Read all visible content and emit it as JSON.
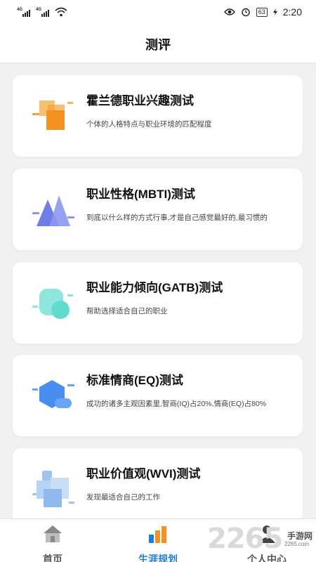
{
  "status_bar": {
    "signal1_label": "4G",
    "signal2_label": "4G",
    "battery": "63",
    "time": "2:20"
  },
  "header": {
    "title": "测评"
  },
  "tests": [
    {
      "title": "霍兰德职业兴趣测试",
      "desc": "个体的人格特点与职业环境的匹配程度",
      "icon": "blocks-icon"
    },
    {
      "title": "职业性格(MBTI)测试",
      "desc": "到底以什么样的方式行事,才是自己感觉最好的,最习惯的",
      "icon": "mountains-icon"
    },
    {
      "title": "职业能力倾向(GATB)测试",
      "desc": "帮助选择适合自己的职业",
      "icon": "bubbles-icon"
    },
    {
      "title": "标准情商(EQ)测试",
      "desc": "成功的诸多主观因素里,智商(IQ)占20%,情商(EQ)占80%",
      "icon": "hexagon-icon"
    },
    {
      "title": "职业价值观(WVI)测试",
      "desc": "发现最适合自己的工作",
      "icon": "squares-icon"
    }
  ],
  "tabs": [
    {
      "label": "首页",
      "icon": "home-icon",
      "active": false
    },
    {
      "label": "生涯规划",
      "icon": "bar-chart-icon",
      "active": true
    },
    {
      "label": "个人中心",
      "icon": "person-icon",
      "active": false
    }
  ],
  "watermark": {
    "number": "2265",
    "text": "手游网",
    "url": "2265.com"
  },
  "colors": {
    "accent": "#1e7fd6",
    "orange": "#f7a13a",
    "purple": "#6f7de8",
    "teal": "#5fdccf",
    "blue": "#4a8df0",
    "lightblue": "#9fc4ef"
  }
}
